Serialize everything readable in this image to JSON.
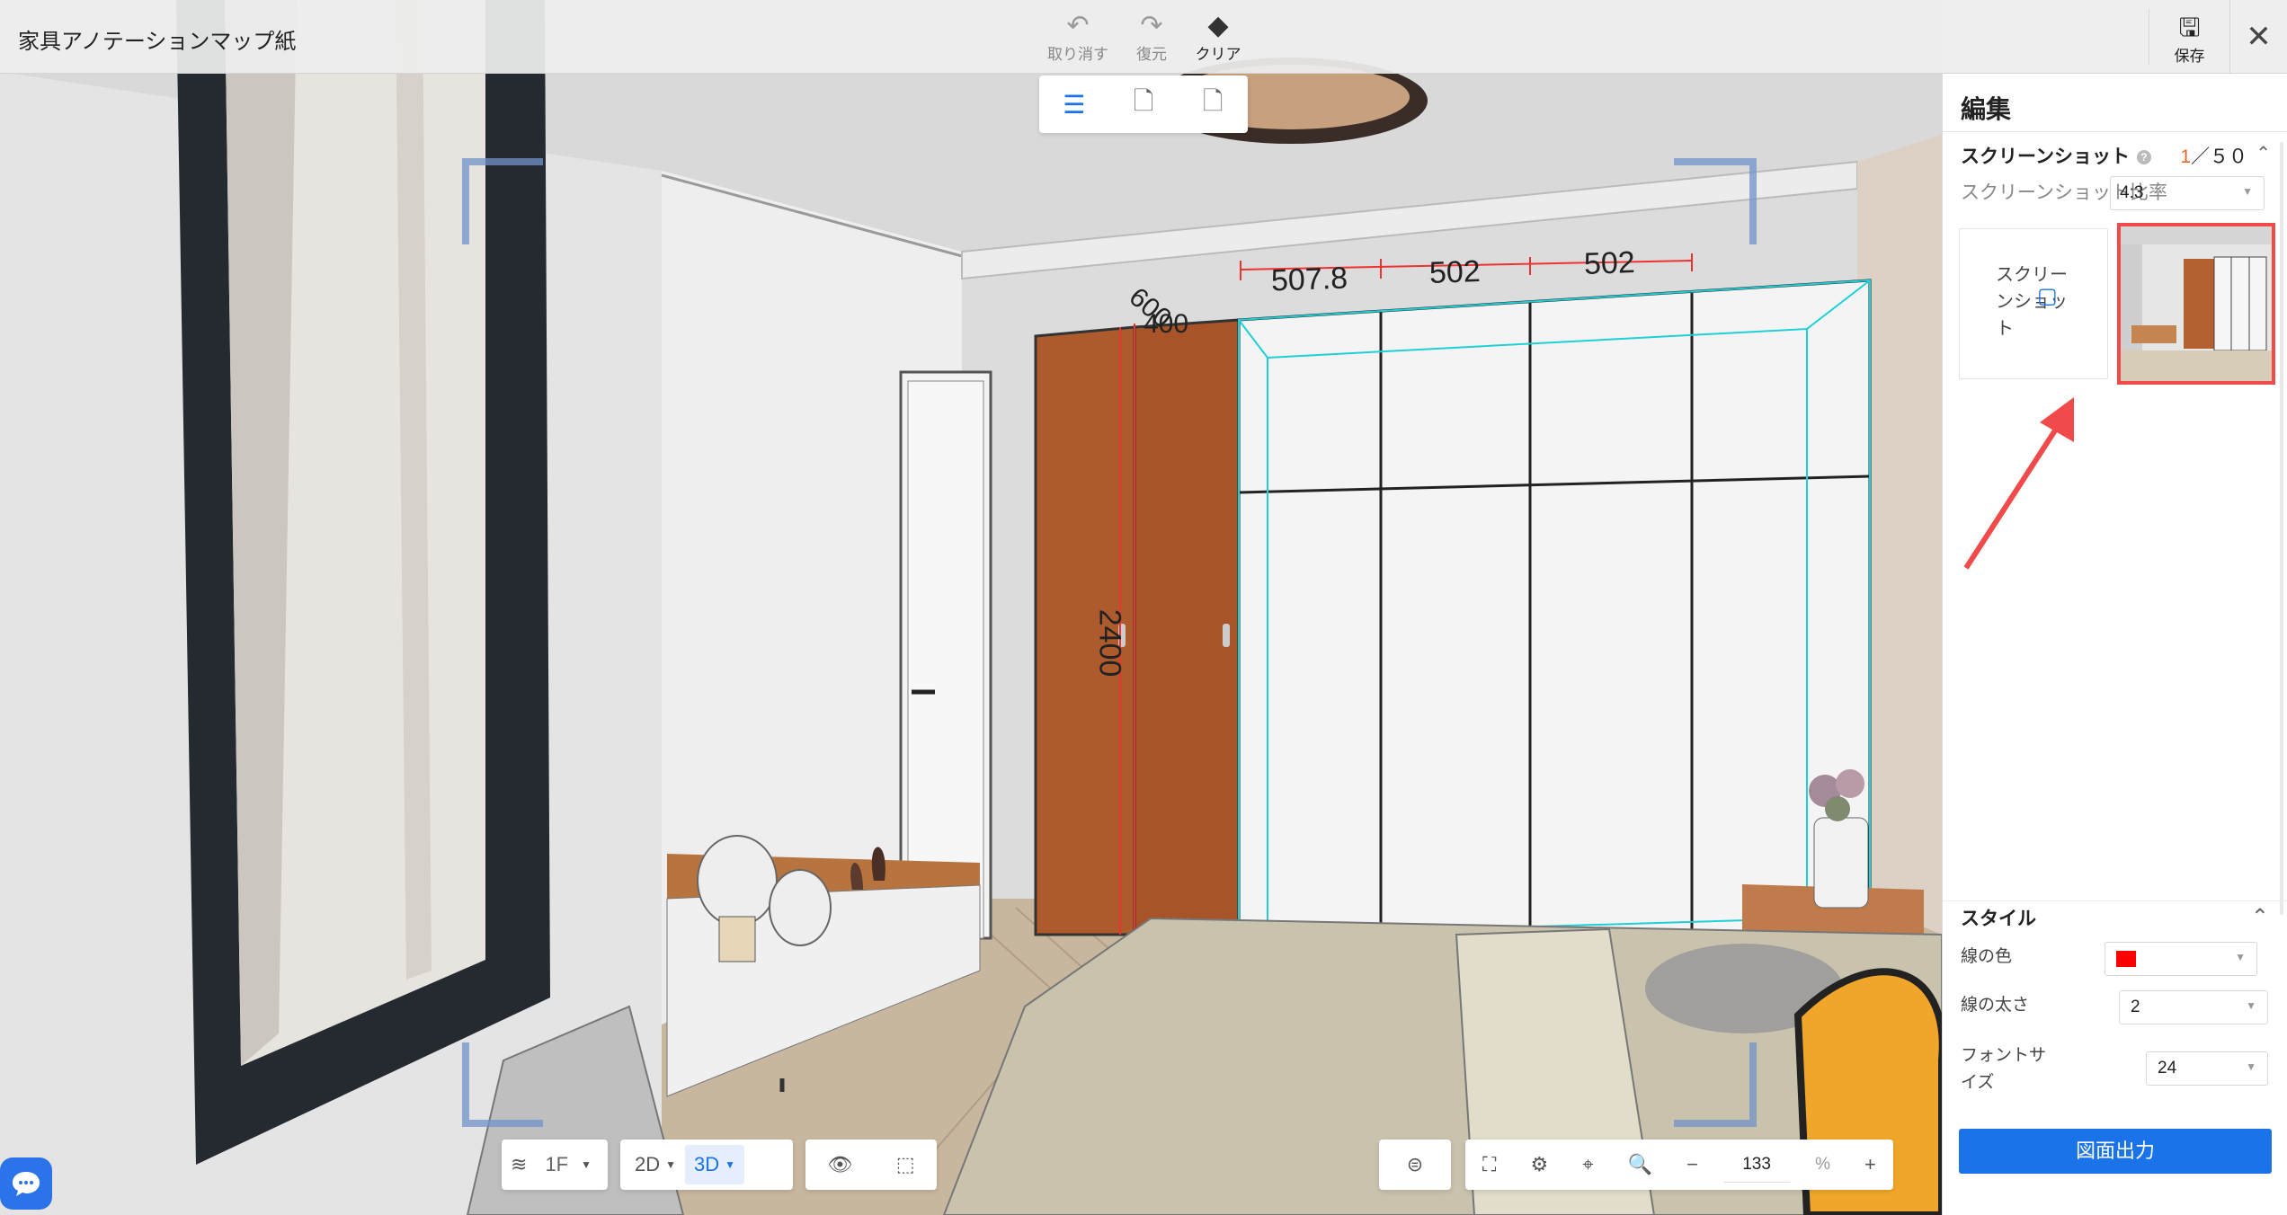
{
  "app": {
    "title": "家具アノテーションマップ紙"
  },
  "toolbar": {
    "undo_label": "取り消す",
    "redo_label": "復元",
    "clear_label": "クリア",
    "save_label": "保存",
    "close_icon": "close-icon"
  },
  "mode_tools": [
    {
      "name": "text-annotation-tool",
      "icon": "text-annotation-icon",
      "active": true
    },
    {
      "name": "component-annotation-tool",
      "icon": "doc-add-icon",
      "active": false
    },
    {
      "name": "component-remove-tool",
      "icon": "doc-remove-icon",
      "active": false
    }
  ],
  "dimensions": {
    "top": [
      "507.8",
      "502",
      "502"
    ],
    "depth": [
      "600",
      "400"
    ],
    "height": "2400"
  },
  "panel": {
    "title": "編集",
    "screenshot": {
      "title": "スクリーンショット",
      "count_current": "1",
      "count_total": "／５０",
      "ratio_label": "スクリーンショット比率",
      "ratio_value": "4:3",
      "add_label": "スクリーンショット"
    },
    "style": {
      "title": "スタイル",
      "line_color_label": "線の色",
      "line_color_value": "#ff0000",
      "line_width_label": "線の太さ",
      "line_width_value": "2",
      "font_size_label": "フォントサイズ",
      "font_size_value": "24"
    },
    "export_label": "図面出力"
  },
  "bottom": {
    "floor": "1F",
    "view_2d": "2D",
    "view_3d": "3D",
    "view_selected": "3D",
    "zoom_value": "133",
    "zoom_unit": "%"
  },
  "colors": {
    "accent": "#1a73e8",
    "annotation": "#ff0000",
    "highlight": "#f04a4a",
    "wardrobe_wood": "#a8562a"
  }
}
